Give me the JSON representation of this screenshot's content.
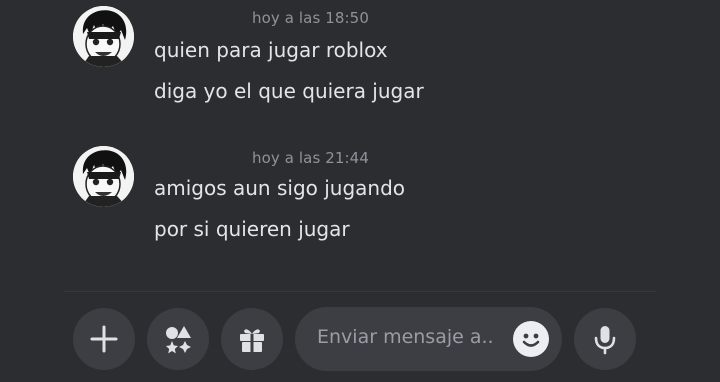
{
  "messages": [
    {
      "timestamp": "hoy a las 18:50",
      "lines": [
        "quien para jugar roblox",
        "diga yo el que quiera jugar"
      ]
    },
    {
      "timestamp": "hoy a las 21:44",
      "lines": [
        "amigos aun sigo jugando",
        "por si quieren jugar"
      ]
    }
  ],
  "composer": {
    "placeholder": "Enviar mensaje a..",
    "icons": {
      "add": "plus-icon",
      "apps": "apps-icon",
      "gift": "gift-icon",
      "emoji": "emoji-icon",
      "mic": "microphone-icon"
    }
  },
  "colors": {
    "background": "#2c2d31",
    "button": "#3c3e44",
    "text": "#e3e4e8",
    "muted": "#8f929a"
  }
}
